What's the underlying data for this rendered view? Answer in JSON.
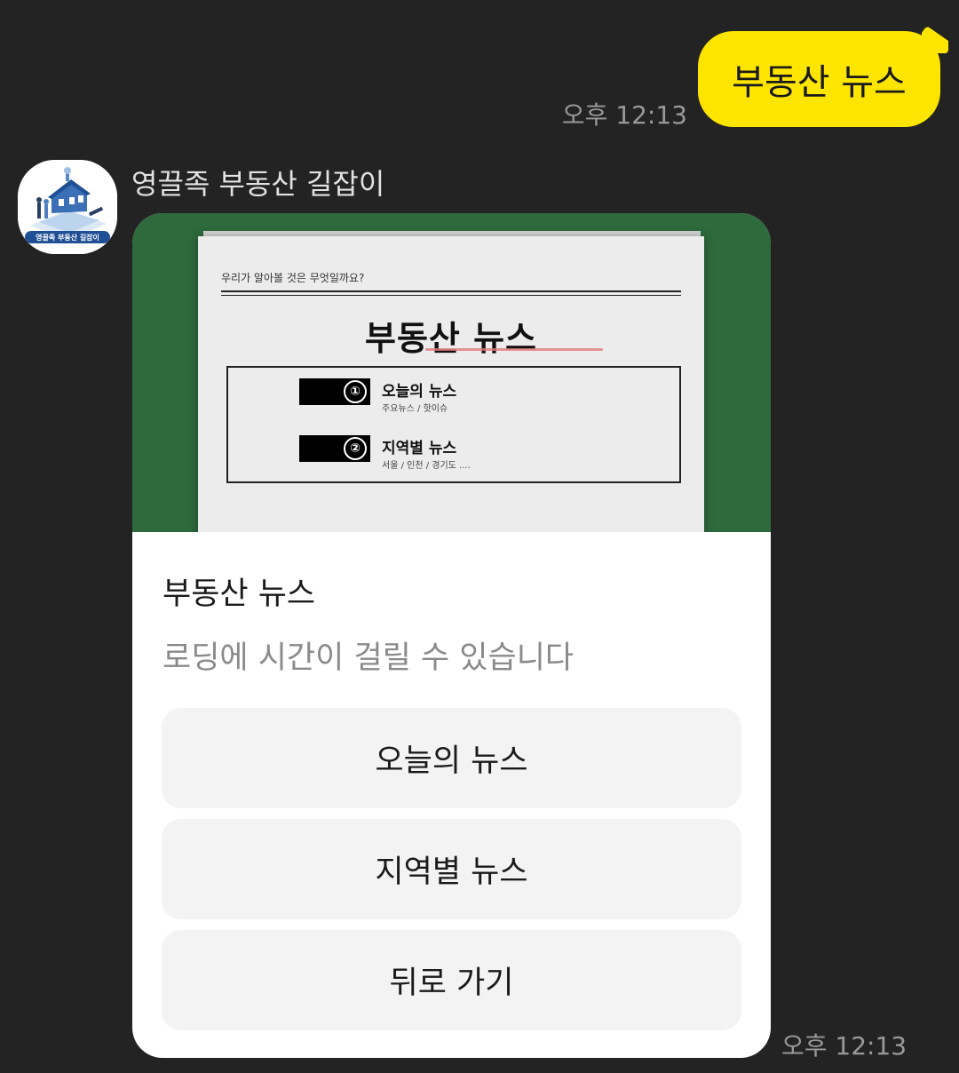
{
  "outgoing": {
    "text": "부동산 뉴스",
    "time": "오후 12:13"
  },
  "incoming": {
    "sender": "영끌족 부동산 길잡이",
    "avatar_caption": "영끌족 부동산 길잡이",
    "time": "오후 12:13",
    "card": {
      "image": {
        "subtitle": "우리가 알아볼 것은 무엇일까요?",
        "title": "부동산 뉴스",
        "items": [
          {
            "num": "①",
            "title": "오늘의 뉴스",
            "sub": "주요뉴스 / 핫이슈"
          },
          {
            "num": "②",
            "title": "지역별 뉴스",
            "sub": "서울 / 인천 / 경기도 ...."
          }
        ]
      },
      "title": "부동산 뉴스",
      "description": "로딩에 시간이 걸릴 수 있습니다",
      "buttons": [
        {
          "label": "오늘의 뉴스"
        },
        {
          "label": "지역별 뉴스"
        },
        {
          "label": "뒤로 가기"
        }
      ]
    }
  },
  "colors": {
    "background": "#232323",
    "outgoing_bubble": "#fee500",
    "card_image_bg": "#2e6a3c",
    "button_bg": "#f3f3f3"
  }
}
